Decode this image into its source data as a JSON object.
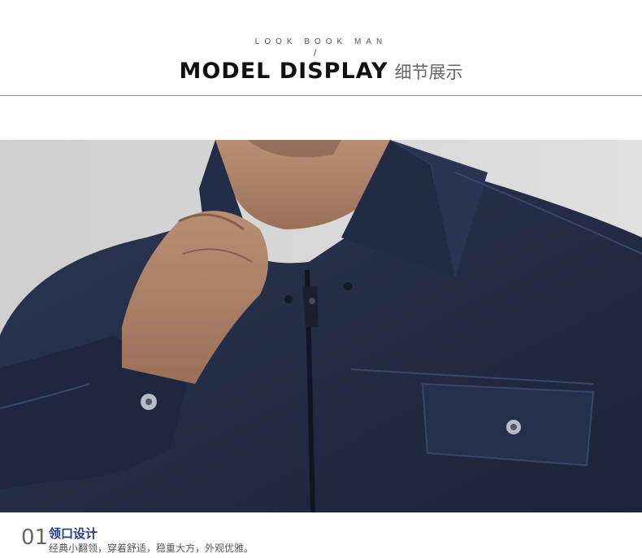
{
  "header": {
    "subtitle": "LOOK BOOK MAN",
    "title_en": "MODEL DISPLAY",
    "title_cn": "细节展示"
  },
  "caption": {
    "number": "01",
    "title": "领口设计",
    "description": "经典小翻领，穿着舒适，稳重大方，外观优雅。"
  },
  "colors": {
    "jacket": "#232c44",
    "background_gray": "#d6d6d6",
    "caption_title": "#1f3d8c"
  }
}
